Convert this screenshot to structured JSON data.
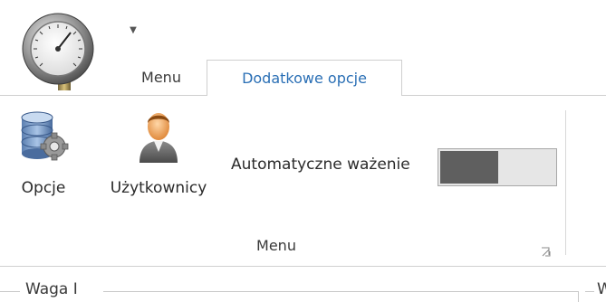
{
  "window": {
    "quick_access_toolbar": {
      "dropdown_icon": "chevron-down-small"
    },
    "app_button": {
      "icon": "pressure-gauge-icon"
    }
  },
  "tabs": [
    {
      "label": "Menu",
      "active": false
    },
    {
      "label": "Dodatkowe opcje",
      "active": true
    }
  ],
  "ribbon": {
    "group": {
      "label": "Menu",
      "buttons": [
        {
          "label": "Opcje",
          "icon": "database-gear-icon"
        },
        {
          "label": "Użytkownicy",
          "icon": "user-icon"
        }
      ],
      "toggle": {
        "label": "Automatyczne ważenie",
        "state": "off"
      },
      "launcher_icon": "dialog-launcher-icon"
    }
  },
  "group_boxes": [
    {
      "title": "Waga I"
    },
    {
      "title": "W"
    }
  ],
  "colors": {
    "active_tab_text": "#2a6fb5",
    "toggle_knob": "#5f5f5f",
    "toggle_track": "#e6e6e6"
  }
}
